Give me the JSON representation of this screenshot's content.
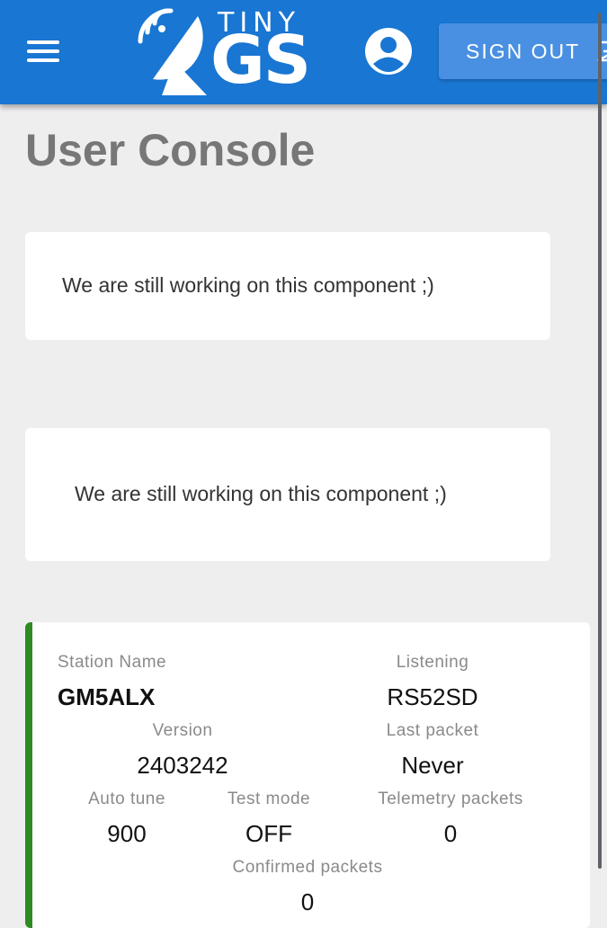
{
  "header": {
    "logo_top": "TINY",
    "logo_main": "GS",
    "signout_label": "SIGN OUT",
    "icons": {
      "menu": "hamburger-menu-icon",
      "account": "account-circle-icon",
      "signout": "exit-icon",
      "logo": "satellite-dish-icon"
    }
  },
  "page": {
    "title": "User Console"
  },
  "placeholder_cards": [
    {
      "text": "We are still working on this component ;)"
    },
    {
      "text": "We are still working on this component ;)"
    }
  ],
  "station": {
    "status_color": "#2e8b22",
    "name_label": "Station Name",
    "name": "GM5ALX",
    "listening_label": "Listening",
    "listening": "RS52SD",
    "version_label": "Version",
    "version": "2403242",
    "last_packet_label": "Last packet",
    "last_packet": "Never",
    "auto_tune_label": "Auto tune",
    "auto_tune": "900",
    "test_mode_label": "Test mode",
    "test_mode": "OFF",
    "telemetry_label": "Telemetry packets",
    "telemetry": "0",
    "confirmed_label": "Confirmed packets",
    "confirmed": "0"
  }
}
